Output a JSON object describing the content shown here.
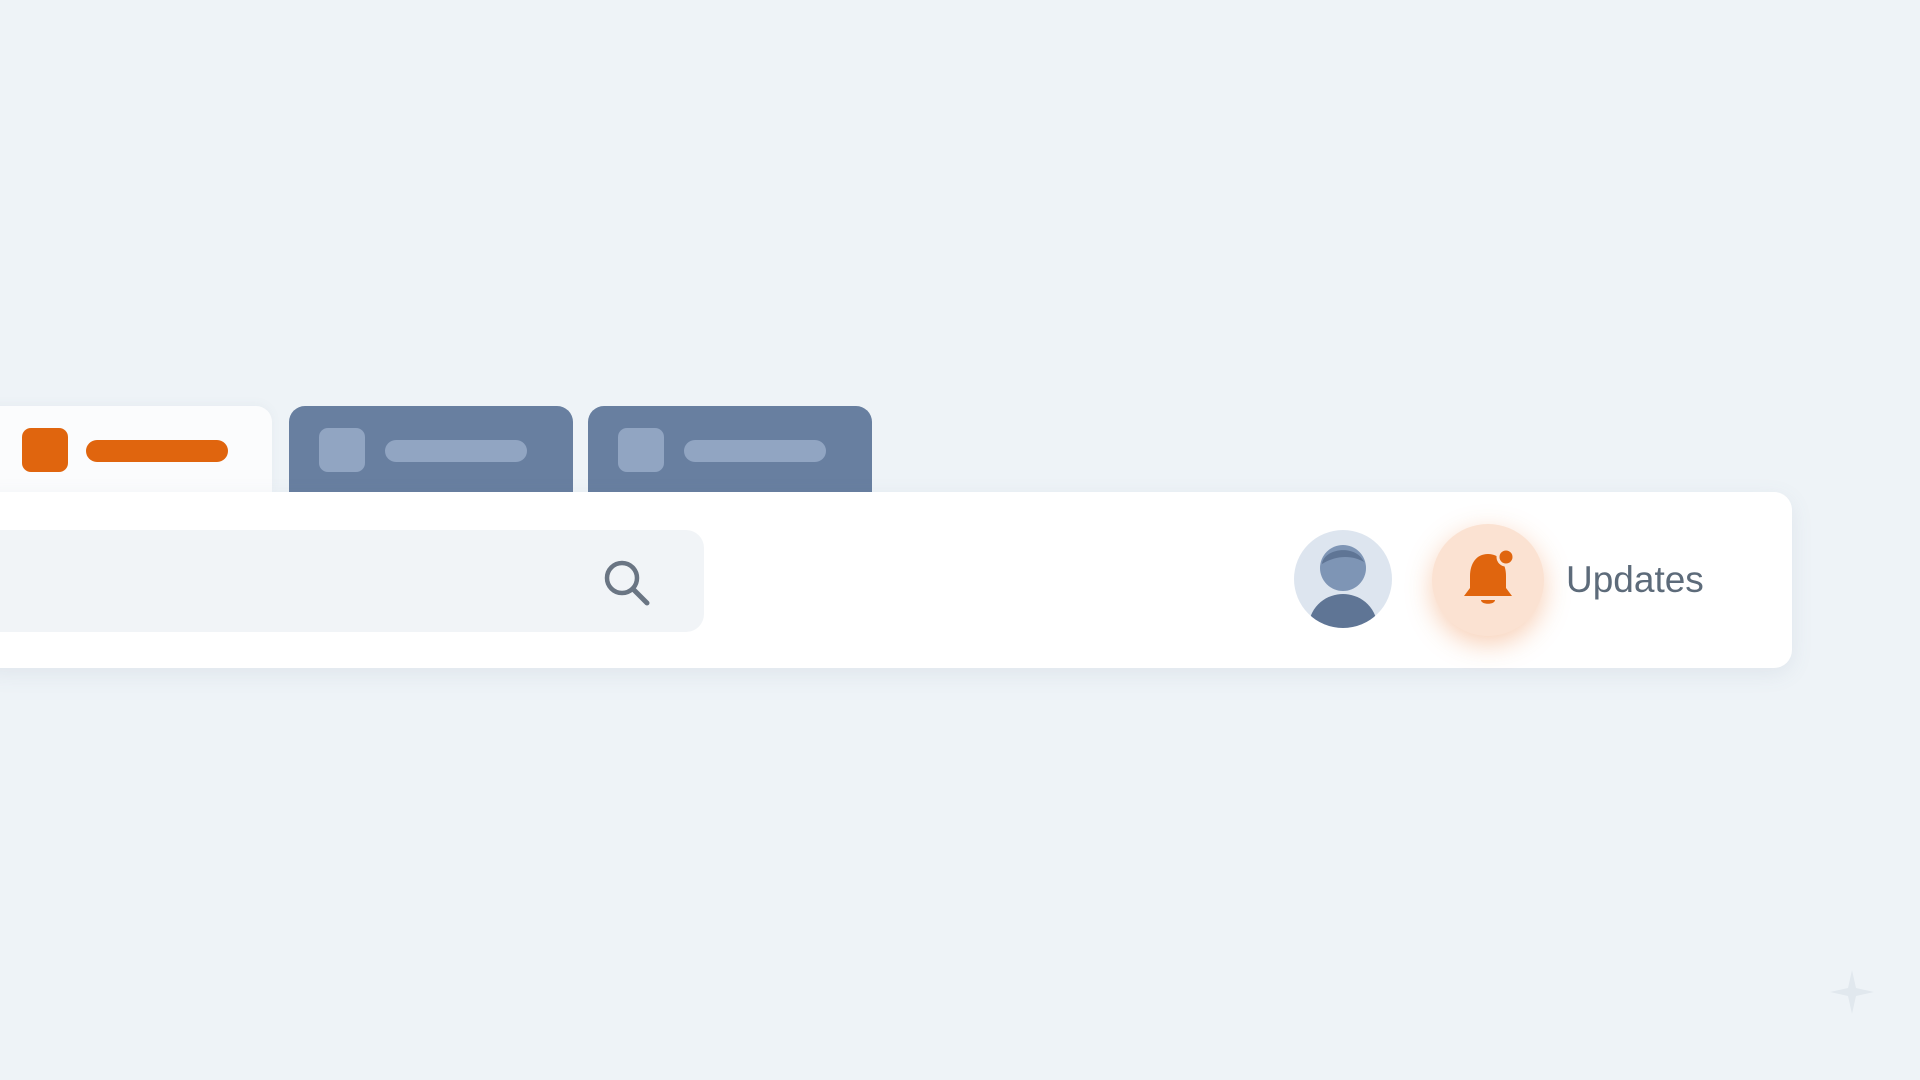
{
  "tabs": [
    {
      "state": "active",
      "icon": "tab-square-icon",
      "color": "#e0650e"
    },
    {
      "state": "inactive",
      "icon": "tab-square-icon",
      "color": "#687fa0"
    },
    {
      "state": "inactive",
      "icon": "tab-square-icon",
      "color": "#687fa0"
    }
  ],
  "search": {
    "value": "",
    "placeholder": "",
    "icon": "search-icon"
  },
  "avatar": {
    "icon": "user-avatar-icon"
  },
  "notifications": {
    "icon": "bell-icon",
    "has_unread_dot": true,
    "label": "Updates"
  },
  "colors": {
    "accent": "#e0650e",
    "tab_inactive": "#687fa0",
    "background": "#eef3f7",
    "card": "#ffffff",
    "text": "#5d6b7a"
  }
}
